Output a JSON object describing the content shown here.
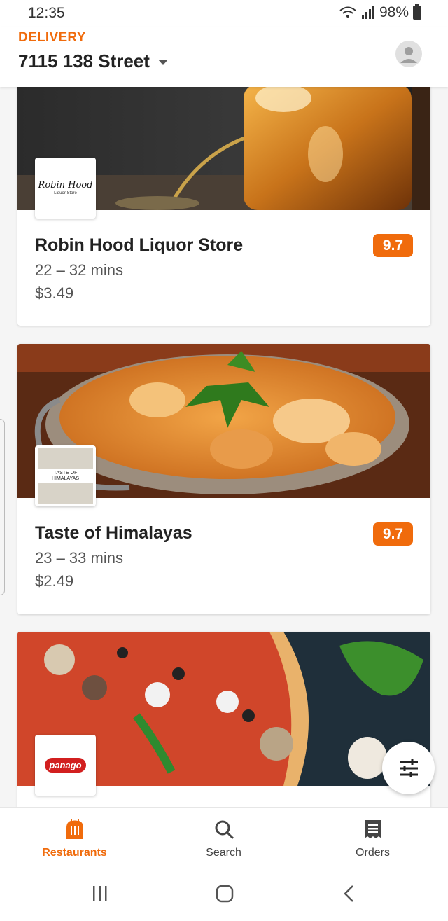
{
  "status_bar": {
    "time": "12:35",
    "battery": "98%"
  },
  "header": {
    "mode_label": "DELIVERY",
    "address": "7115 138 Street"
  },
  "restaurants": [
    {
      "name": "Robin Hood Liquor Store",
      "time": "22 – 32 mins",
      "fee": "$3.49",
      "rating": "9.7",
      "logo_text": "Robin Hood",
      "logo_sub": "Liquor Store"
    },
    {
      "name": "Taste of Himalayas",
      "time": "23 – 33 mins",
      "fee": "$2.49",
      "rating": "9.7",
      "logo_text": "TASTE OF HIMALAYAS"
    },
    {
      "logo_text": "panago"
    }
  ],
  "bottom_nav": [
    {
      "label": "Restaurants",
      "icon": "restaurant-icon",
      "active": true
    },
    {
      "label": "Search",
      "icon": "search-icon",
      "active": false
    },
    {
      "label": "Orders",
      "icon": "receipt-icon",
      "active": false
    }
  ],
  "colors": {
    "accent": "#f06b0c",
    "text": "#222222",
    "muted": "#555555"
  }
}
